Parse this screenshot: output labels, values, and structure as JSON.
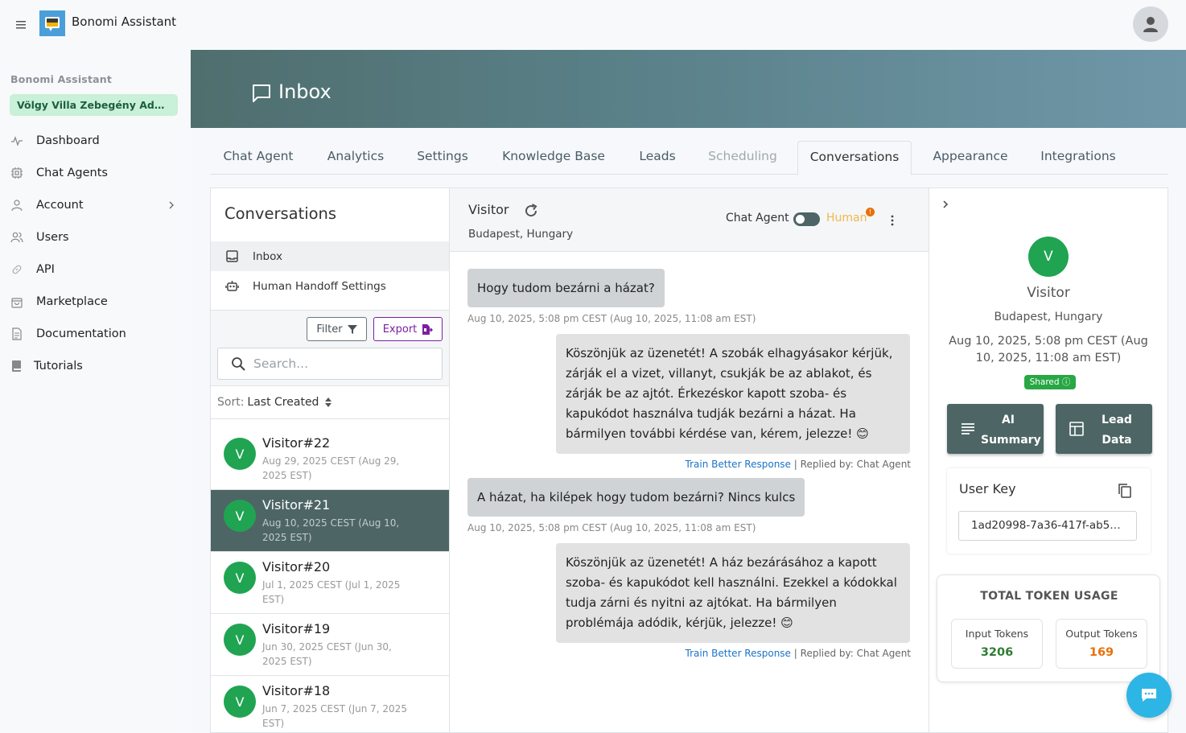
{
  "app": {
    "brand": "Bonomi Assistant"
  },
  "sidebar": {
    "title": "Bonomi Assistant",
    "workspace": "Völgy Villa Zebegény Adm...",
    "items": [
      {
        "label": "Dashboard",
        "icon": "activity-icon"
      },
      {
        "label": "Chat Agents",
        "icon": "cpu-icon"
      },
      {
        "label": "Account",
        "icon": "user-icon"
      },
      {
        "label": "Users",
        "icon": "users-icon"
      },
      {
        "label": "API",
        "icon": "link-icon"
      },
      {
        "label": "Marketplace",
        "icon": "shopping-bag-icon"
      },
      {
        "label": "Documentation",
        "icon": "document-icon"
      },
      {
        "label": "Tutorials",
        "icon": "book-icon"
      }
    ]
  },
  "banner": {
    "title": "Inbox"
  },
  "tabs": [
    "Chat Agent",
    "Analytics",
    "Settings",
    "Knowledge Base",
    "Leads",
    "Scheduling",
    "Conversations",
    "Appearance",
    "Integrations"
  ],
  "active_tab": "Conversations",
  "conversations": {
    "title": "Conversations",
    "nav": [
      "Inbox",
      "Human Handoff Settings"
    ],
    "filter_label": "Filter",
    "export_label": "Export",
    "search_placeholder": "Search...",
    "sort_prefix": "Sort:",
    "sort_value": "Last Created",
    "list": [
      {
        "avatar": "V",
        "name": "Visitor#22",
        "date": "Aug 29, 2025 CEST (Aug 29, 2025 EST)"
      },
      {
        "avatar": "V",
        "name": "Visitor#21",
        "date": "Aug 10, 2025 CEST (Aug 10, 2025 EST)"
      },
      {
        "avatar": "V",
        "name": "Visitor#20",
        "date": "Jul 1, 2025 CEST (Jul 1, 2025 EST)"
      },
      {
        "avatar": "V",
        "name": "Visitor#19",
        "date": "Jun 30, 2025 CEST (Jun 30, 2025 EST)"
      },
      {
        "avatar": "V",
        "name": "Visitor#18",
        "date": "Jun 7, 2025 CEST (Jun 7, 2025 EST)"
      }
    ]
  },
  "chat": {
    "name": "Visitor",
    "location": "Budapest, Hungary",
    "agent_label": "Chat Agent",
    "human_label": "Human",
    "badge": "!",
    "messages": [
      {
        "from": "user",
        "text": "Hogy tudom bezárni a házat?",
        "ts": "Aug 10, 2025, 5:08 pm CEST (Aug 10, 2025, 11:08 am EST)"
      },
      {
        "from": "bot",
        "text": "Köszönjük az üzenetét! A szobák elhagyásakor kérjük, zárják el a vizet, villanyt, csukják be az ablakot, és zárják be az ajtót. Érkezéskor kapott szoba- és kapukódot használva tudják bezárni a házat. Ha bármilyen további kérdése van, kérem, jelezze! 😊",
        "train": "Train Better Response",
        "replied": "| Replied by: Chat Agent"
      },
      {
        "from": "user",
        "text": "A házat, ha kilépek hogy tudom bezárni? Nincs kulcs",
        "ts": "Aug 10, 2025, 5:08 pm CEST (Aug 10, 2025, 11:08 am EST)"
      },
      {
        "from": "bot",
        "text": "Köszönjük az üzenetét! A ház bezárásához a kapott szoba- és kapukódot kell használni. Ezekkel a kódokkal tudja zárni és nyitni az ajtókat. Ha bármilyen problémája adódik, kérjük, jelezze! 😊",
        "train": "Train Better Response",
        "replied": "| Replied by: Chat Agent"
      }
    ]
  },
  "visitor": {
    "avatar": "V",
    "name": "Visitor",
    "location": "Budapest, Hungary",
    "date": "Aug 10, 2025, 5:08 pm CEST (Aug 10, 2025, 11:08 am EST)",
    "shared": "Shared",
    "ai_summary": "AI Summary",
    "lead_data": "Lead Data",
    "user_key_label": "User Key",
    "user_key": "1ad20998-7a36-417f-ab5c-...",
    "token_title": "TOTAL TOKEN USAGE",
    "input_label": "Input Tokens",
    "input_value": "3206",
    "output_label": "Output Tokens",
    "output_value": "169"
  },
  "colors": {
    "accent": "#4d6565",
    "green": "#20a451",
    "input_tokens": "#2e7d32",
    "output_tokens": "#e8710a",
    "link": "#1a73c8"
  }
}
